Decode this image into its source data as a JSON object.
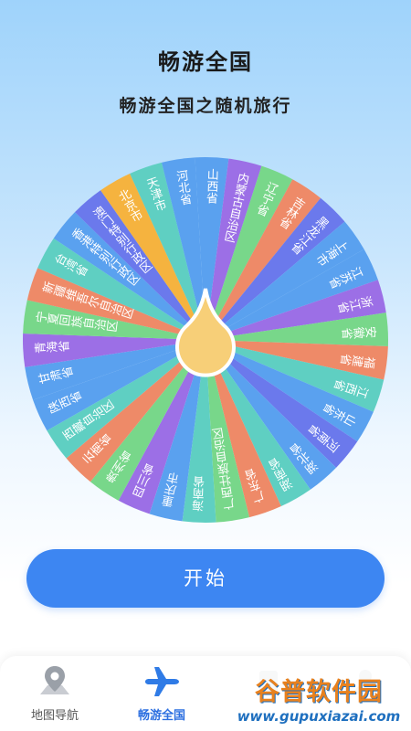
{
  "app": {
    "title": "畅游全国",
    "subtitle": "畅游全国之随机旅行"
  },
  "wheel": {
    "segments": [
      {
        "label": "山西省",
        "color": "#5aa1ef"
      },
      {
        "label": "内蒙古自治区",
        "color": "#9c6fe6"
      },
      {
        "label": "辽宁省",
        "color": "#78d78a"
      },
      {
        "label": "吉林省",
        "color": "#ee8a68"
      },
      {
        "label": "黑龙江省",
        "color": "#6b79ec"
      },
      {
        "label": "上海市",
        "color": "#5aa1ef"
      },
      {
        "label": "江苏省",
        "color": "#5aa1ef"
      },
      {
        "label": "浙江省",
        "color": "#9c6fe6"
      },
      {
        "label": "安徽省",
        "color": "#78d78a"
      },
      {
        "label": "福建省",
        "color": "#ee8a68"
      },
      {
        "label": "江西省",
        "color": "#5fcfc2"
      },
      {
        "label": "山东省",
        "color": "#5aa1ef"
      },
      {
        "label": "河南省",
        "color": "#6b79ec"
      },
      {
        "label": "湖北省",
        "color": "#5aa1ef"
      },
      {
        "label": "湖南省",
        "color": "#5fcfc2"
      },
      {
        "label": "广东省",
        "color": "#ee8a68"
      },
      {
        "label": "广西壮族自治区",
        "color": "#78d78a"
      },
      {
        "label": "海南省",
        "color": "#5fcfc2"
      },
      {
        "label": "重庆市",
        "color": "#5aa1ef"
      },
      {
        "label": "四川省",
        "color": "#9c6fe6"
      },
      {
        "label": "贵州省",
        "color": "#78d78a"
      },
      {
        "label": "云南省",
        "color": "#ee8a68"
      },
      {
        "label": "西藏自治区",
        "color": "#5fcfc2"
      },
      {
        "label": "陕西省",
        "color": "#5aa1ef"
      },
      {
        "label": "甘肃省",
        "color": "#5aa1ef"
      },
      {
        "label": "青海省",
        "color": "#9c6fe6"
      },
      {
        "label": "宁夏回族自治区",
        "color": "#78d78a"
      },
      {
        "label": "新疆维吾尔自治区",
        "color": "#ee8a68"
      },
      {
        "label": "台湾省",
        "color": "#5fcfc2"
      },
      {
        "label": "香港特别行政区",
        "color": "#5aa1ef"
      },
      {
        "label": "澳门特别行政区",
        "color": "#6b79ec"
      },
      {
        "label": "北京市",
        "color": "#f5b33f"
      },
      {
        "label": "天津市",
        "color": "#5fcfc2"
      },
      {
        "label": "河北省",
        "color": "#5aa1ef"
      }
    ],
    "pointer_color": "#f7cf78"
  },
  "start_button": {
    "label": "开始"
  },
  "tabs": [
    {
      "label": "地图导航",
      "icon": "map-pin-icon",
      "active": false
    },
    {
      "label": "畅游全国",
      "icon": "airplane-icon",
      "active": true
    },
    {
      "label": "",
      "icon": "unknown-icon",
      "active": false
    },
    {
      "label": "",
      "icon": "unknown-icon",
      "active": false
    }
  ],
  "watermark": {
    "logo": "谷普软件园",
    "url": "www.gupuxiazai.com"
  }
}
